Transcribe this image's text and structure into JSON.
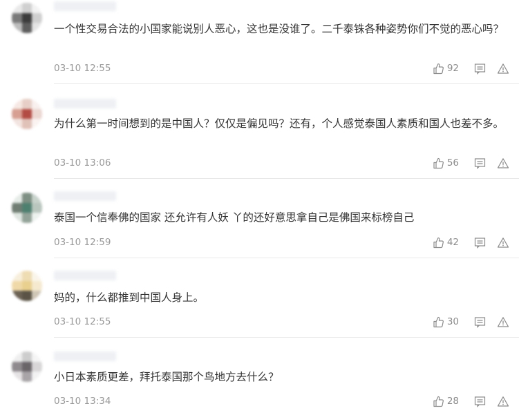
{
  "comments": [
    {
      "text": "一个性交易合法的小国家能说别人恶心，这也是没谁了。二千泰铢各种姿势你们不觉的恶心吗？",
      "time": "03-10 12:55",
      "likes": "92",
      "avatar_colors": [
        "#e9e9e9",
        "#d0d0d0",
        "#f2f2f2",
        "#7a7a7a",
        "#3c3c3c",
        "#cfcfcf",
        "#bdbdbd",
        "#5e5e5e",
        "#e4e4e4"
      ]
    },
    {
      "text": "为什么第一时间想到的是中国人？仅仅是偏见吗？还有，个人感觉泰国人素质和国人也差不多。",
      "time": "03-10 13:06",
      "likes": "56",
      "avatar_colors": [
        "#f6e8e3",
        "#e7cfc7",
        "#f7f0ee",
        "#d79f92",
        "#b34c43",
        "#ecd7d1",
        "#f2e4e0",
        "#e1c2b9",
        "#faf3f1"
      ]
    },
    {
      "text": "泰国一个信奉佛的国家 还允许有人妖 丫的还好意思拿自己是佛国来标榜自己",
      "time": "03-10 12:59",
      "likes": "42",
      "avatar_colors": [
        "#e6ece8",
        "#7e8f83",
        "#c7d2cb",
        "#6f7d73",
        "#4e8070",
        "#b9c6be",
        "#dfe6e1",
        "#93a399",
        "#eef2ef"
      ]
    },
    {
      "text": "妈的，什么都推到中国人身上。",
      "time": "03-10 12:55",
      "likes": "30",
      "avatar_colors": [
        "#f7efdc",
        "#eedcb3",
        "#faf5ea",
        "#f0d9a8",
        "#e9d08f",
        "#f5ead0",
        "#6b6254",
        "#5b5446",
        "#cfc6b6"
      ]
    },
    {
      "text": "小日本素质更差，拜托泰国那个鸟地方去什么？",
      "time": "03-10 13:34",
      "likes": "28",
      "avatar_colors": [
        "#efefef",
        "#cdcdcd",
        "#f5f5f5",
        "#8e8a8d",
        "#6a6569",
        "#d8d6d7",
        "#e6e3e5",
        "#a8a4a7",
        "#f3f2f3"
      ]
    }
  ]
}
